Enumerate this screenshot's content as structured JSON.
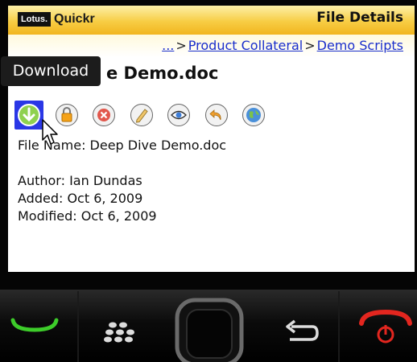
{
  "header": {
    "logo_badge": "Lotus.",
    "logo_text": "Quickr",
    "title": "File Details"
  },
  "breadcrumb": {
    "ellipsis": "...",
    "separator": ">",
    "items": [
      "Product Collateral",
      "Demo Scripts"
    ]
  },
  "document": {
    "name_visible": "e Demo.doc"
  },
  "tooltip": {
    "text": "Download"
  },
  "toolbar": {
    "actions": [
      "download-icon",
      "lock-icon",
      "delete-icon",
      "edit-icon",
      "view-icon",
      "undo-icon",
      "globe-icon"
    ],
    "selected": "download-icon"
  },
  "details": {
    "file_name_line": "File Name: Deep Dive Demo.doc",
    "author_line": "Author: Ian Dundas",
    "added_line": "Added: Oct 6, 2009",
    "modified_line": "Modified: Oct 6, 2009"
  },
  "colors": {
    "header_gradient_top": "#fdf0a8",
    "header_gradient_bottom": "#f1b51e",
    "link": "#1a2ecc",
    "selected_tool": "#2a37e6"
  }
}
